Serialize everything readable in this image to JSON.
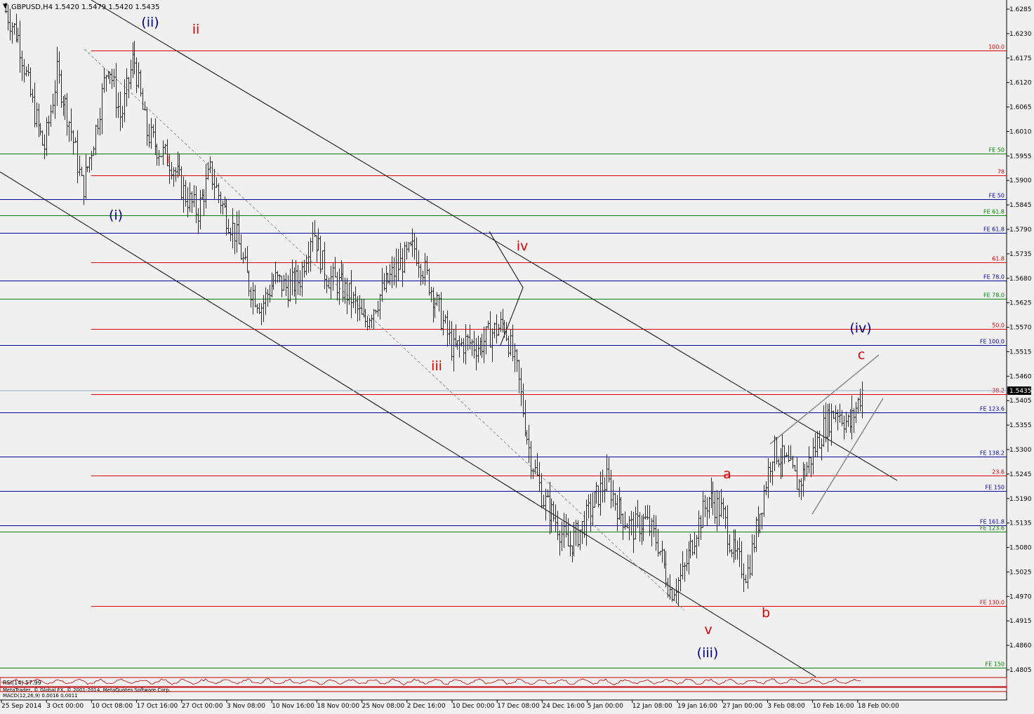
{
  "chart_header": {
    "symbol_label": "GBPUSD,H4",
    "ohlc": "1.5420 1.5479 1.5420 1.5435"
  },
  "current_price_label": "1.5435",
  "chart_data": {
    "type": "candlestick",
    "title": "GBPUSD,H4",
    "y_ticks": [
      "1.6285",
      "1.6230",
      "1.6175",
      "1.6120",
      "1.6065",
      "1.6010",
      "1.5955",
      "1.5900",
      "1.5845",
      "1.5790",
      "1.5735",
      "1.5680",
      "1.5625",
      "1.5570",
      "1.5515",
      "1.5460",
      "1.5405",
      "1.5355",
      "1.5300",
      "1.5245",
      "1.5190",
      "1.5135",
      "1.5080",
      "1.5025",
      "1.4970",
      "1.4915",
      "1.4860",
      "1.4805"
    ],
    "ylim": [
      1.4775,
      1.6305
    ],
    "x_ticks": [
      "25 Sep 2014",
      "3 Oct 00:00",
      "10 Oct 08:00",
      "17 Oct 16:00",
      "27 Oct 00:00",
      "3 Nov 08:00",
      "10 Nov 16:00",
      "18 Nov 00:00",
      "25 Nov 08:00",
      "2 Dec 16:00",
      "10 Dec 00:00",
      "17 Dec 08:00",
      "24 Dec 16:00",
      "5 Jan 00:00",
      "12 Jan 08:00",
      "19 Jan 16:00",
      "27 Jan 00:00",
      "3 Feb 08:00",
      "10 Feb 16:00",
      "18 Feb 00:00"
    ],
    "approx_path": [
      [
        0,
        1.628
      ],
      [
        1,
        1.622
      ],
      [
        2,
        1.608
      ],
      [
        3,
        1.597
      ],
      [
        4,
        1.614
      ],
      [
        5,
        1.603
      ],
      [
        6,
        1.588
      ],
      [
        7,
        1.601
      ],
      [
        8,
        1.617
      ],
      [
        9,
        1.604
      ],
      [
        10,
        1.618
      ],
      [
        11,
        1.601
      ],
      [
        12,
        1.597
      ],
      [
        13,
        1.594
      ],
      [
        14,
        1.587
      ],
      [
        15,
        1.583
      ],
      [
        16,
        1.592
      ],
      [
        17,
        1.584
      ],
      [
        18,
        1.578
      ],
      [
        19,
        1.567
      ],
      [
        20,
        1.562
      ],
      [
        21,
        1.568
      ],
      [
        22,
        1.566
      ],
      [
        23,
        1.568
      ],
      [
        24,
        1.58
      ],
      [
        25,
        1.569
      ],
      [
        26,
        1.567
      ],
      [
        27,
        1.564
      ],
      [
        28,
        1.558
      ],
      [
        29,
        1.563
      ],
      [
        30,
        1.568
      ],
      [
        31,
        1.572
      ],
      [
        32,
        1.575
      ],
      [
        33,
        1.568
      ],
      [
        34,
        1.56
      ],
      [
        35,
        1.552
      ],
      [
        36,
        1.554
      ],
      [
        37,
        1.553
      ],
      [
        38,
        1.556
      ],
      [
        39,
        1.558
      ],
      [
        40,
        1.547
      ],
      [
        41,
        1.529
      ],
      [
        42,
        1.519
      ],
      [
        43,
        1.514
      ],
      [
        44,
        1.508
      ],
      [
        45,
        1.512
      ],
      [
        46,
        1.518
      ],
      [
        47,
        1.523
      ],
      [
        48,
        1.516
      ],
      [
        49,
        1.512
      ],
      [
        50,
        1.514
      ],
      [
        51,
        1.509
      ],
      [
        52,
        1.498
      ],
      [
        53,
        1.502
      ],
      [
        54,
        1.512
      ],
      [
        55,
        1.519
      ],
      [
        56,
        1.516
      ],
      [
        57,
        1.506
      ],
      [
        58,
        1.502
      ],
      [
        59,
        1.516
      ],
      [
        60,
        1.53
      ],
      [
        61,
        1.527
      ],
      [
        62,
        1.522
      ],
      [
        63,
        1.528
      ],
      [
        64,
        1.535
      ],
      [
        65,
        1.539
      ],
      [
        66,
        1.535
      ],
      [
        67,
        1.543
      ]
    ]
  },
  "horizontal_levels": [
    {
      "label": "100.0",
      "price": 1.6193,
      "color": "#e00000"
    },
    {
      "label": "FE 50",
      "price": 1.5962,
      "color": "#008000"
    },
    {
      "label": "78",
      "price": 1.5912,
      "color": "#e00000"
    },
    {
      "label": "FE 50",
      "price": 1.586,
      "color": "#0000a0"
    },
    {
      "label": "FE 61.8",
      "price": 1.5823,
      "color": "#008000"
    },
    {
      "label": "FE 61.8",
      "price": 1.5784,
      "color": "#0000a0"
    },
    {
      "label": "61.8",
      "price": 1.5718,
      "color": "#e00000"
    },
    {
      "label": "FE 78.0",
      "price": 1.5677,
      "color": "#0000a0"
    },
    {
      "label": "FE 78.0",
      "price": 1.5636,
      "color": "#008000"
    },
    {
      "label": "50.0",
      "price": 1.5569,
      "color": "#e00000"
    },
    {
      "label": "FE 100.0",
      "price": 1.5532,
      "color": "#0000a0"
    },
    {
      "label": "38.2",
      "price": 1.5422,
      "color": "#e00000"
    },
    {
      "label": "FE 123.6",
      "price": 1.5381,
      "color": "#0000a0"
    },
    {
      "label": "FE 138.2",
      "price": 1.5283,
      "color": "#0000a0"
    },
    {
      "label": "23.6",
      "price": 1.524,
      "color": "#e00000"
    },
    {
      "label": "FE 150",
      "price": 1.5205,
      "color": "#0000a0"
    },
    {
      "label": "FE 161.8",
      "price": 1.5129,
      "color": "#0000a0"
    },
    {
      "label": "FE 123.6",
      "price": 1.5114,
      "color": "#008000"
    },
    {
      "label": "FE 130.0",
      "price": 1.4948,
      "color": "#e00000"
    },
    {
      "label": "FE 150",
      "price": 1.481,
      "color": "#008000"
    }
  ],
  "wave_labels": [
    {
      "text": "(ii)",
      "color": "#00008b"
    },
    {
      "text": "ii",
      "color": "#e00000"
    },
    {
      "text": "i",
      "color": "#e00000"
    },
    {
      "text": "(i)",
      "color": "#00008b"
    },
    {
      "text": "iv",
      "color": "#e00000"
    },
    {
      "text": "iii",
      "color": "#e00000"
    },
    {
      "text": "(iv)",
      "color": "#00008b"
    },
    {
      "text": "c",
      "color": "#e00000"
    },
    {
      "text": "a",
      "color": "#e00000"
    },
    {
      "text": "b",
      "color": "#e00000"
    },
    {
      "text": "v",
      "color": "#e00000"
    },
    {
      "text": "(iii)",
      "color": "#00008b"
    }
  ],
  "indicators": {
    "rsi_label": "RSI(14) 57.99",
    "macd_label": "MACD(12,26,9) 0.0016 0.0011",
    "copyright": "MetaTrader, © Global FX, © 2001-2014, MetaQuotes Software Corp."
  },
  "colors": {
    "background": "#f0f0f0",
    "candle": "#2a2a2a",
    "channel": "#000000",
    "wedge": "#888888",
    "dashed": "#a0a0a0",
    "price_box": "#000000"
  }
}
